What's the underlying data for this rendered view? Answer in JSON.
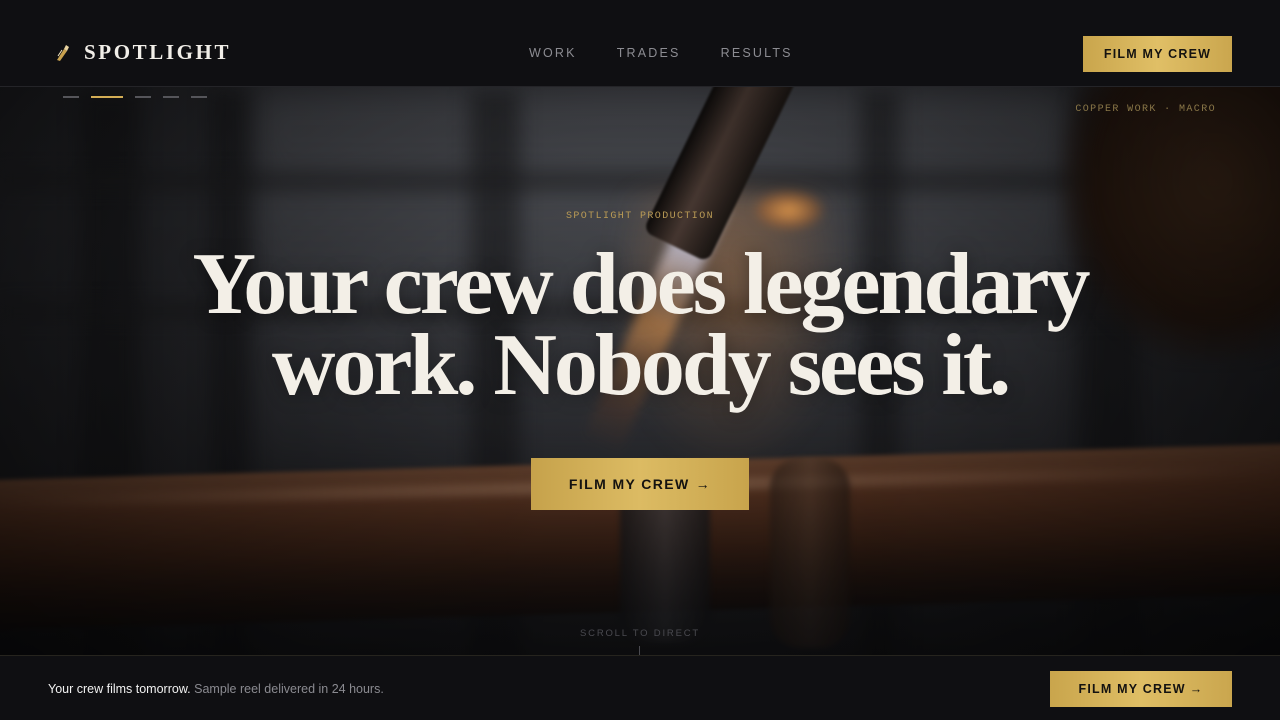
{
  "brand": {
    "name": "SPOTLIGHT",
    "icon": "torch-icon"
  },
  "nav": {
    "items": [
      {
        "label": "WORK"
      },
      {
        "label": "TRADES"
      },
      {
        "label": "RESULTS"
      }
    ]
  },
  "header": {
    "cta_label": "FILM MY CREW"
  },
  "slider": {
    "count": 5,
    "active_index": 1,
    "caption": "COPPER WORK · MACRO"
  },
  "hero": {
    "eyebrow": "SPOTLIGHT PRODUCTION",
    "headline_line1": "Your crew does legendary",
    "headline_line2": "work. Nobody sees it.",
    "cta_label": "FILM MY CREW",
    "cta_arrow": "→",
    "scroll_hint": "SCROLL TO DIRECT"
  },
  "bottom_bar": {
    "strong_text": "Your crew films tomorrow.",
    "muted_text": "Sample reel delivered in 24 hours.",
    "cta_label": "FILM MY CREW",
    "cta_arrow": "→"
  },
  "colors": {
    "accent_gold": "#d6b25a",
    "background": "#0f0f12",
    "headline": "#f3efe7"
  }
}
